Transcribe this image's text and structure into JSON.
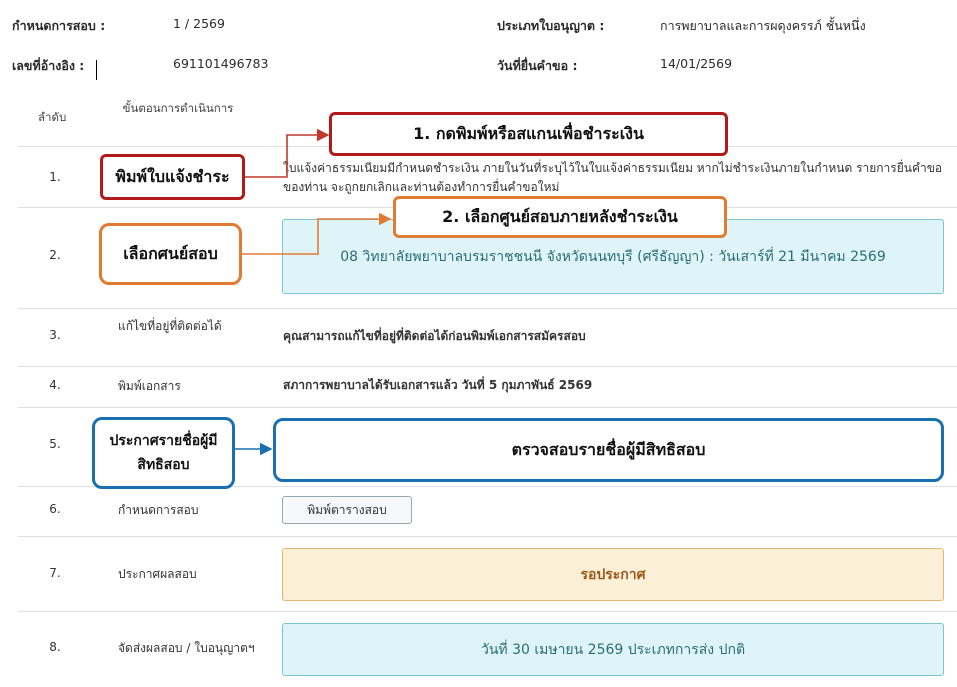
{
  "header": {
    "exam_round_label": "กำหนดการสอบ :",
    "exam_round_value": "1 / 2569",
    "license_type_label": "ประเภทใบอนุญาต :",
    "license_type_value": "การพยาบาลและการผดุงครรภ์ ชั้นหนึ่ง",
    "ref_no_label": "เลขที่อ้างอิง :",
    "ref_no_value": "691101496783",
    "submit_date_label": "วันที่ยื่นคำขอ :",
    "submit_date_value": "14/01/2569"
  },
  "table": {
    "col_order": "ลำดับ",
    "col_step": "ขั้นตอนการดำเนินการ"
  },
  "rows": [
    {
      "num": "1.",
      "detail": "ใบแจ้งค่าธรรมเนียมมีกำหนดชำระเงิน ภายในวันที่ระบุไว้ในใบแจ้งค่าธรรมเนียม หากไม่ชำระเงินภายในกำหนด รายการยื่นคำขอของท่าน จะถูกยกเลิกและท่านต้องทำการยื่นคำขอใหม่"
    },
    {
      "num": "2.",
      "panel": "08 วิทยาลัยพยาบาลบรมราชชนนี จังหวัดนนทบุรี (ศรีธัญญา) : วันเสาร์ที่ 21 มีนาคม 2569"
    },
    {
      "num": "3.",
      "step": "แก้ไขที่อยู่ที่ติดต่อได้",
      "detail": "คุณสามารถแก้ไขที่อยู่ที่ติดต่อได้ก่อนพิมพ์เอกสารสมัครสอบ"
    },
    {
      "num": "4.",
      "step": "พิมพ์เอกสาร",
      "detail": "สภาการพยาบาลได้รับเอกสารแล้ว วันที่ 5 กุมภาพันธ์ 2569"
    },
    {
      "num": "5."
    },
    {
      "num": "6.",
      "step": "กำหนดการสอบ",
      "button": "พิมพ์ตารางสอบ"
    },
    {
      "num": "7.",
      "step": "ประกาศผลสอบ",
      "panel": "รอประกาศ"
    },
    {
      "num": "8.",
      "step": "จัดส่งผลสอบ / ใบอนุญาตฯ",
      "panel": "วันที่ 30 เมษายน 2569 ประเภทการส่ง ปกติ"
    }
  ],
  "callouts": {
    "print_invoice": "พิมพ์ใบแจ้งชำระ",
    "step1_instruction": "1. กดพิมพ์หรือสแกนเพื่อชำระเงิน",
    "select_center": "เลือกศนย์สอบ",
    "step2_instruction": "2. เลือกศูนย์สอบภายหลังชำระเงิน",
    "announce_list": "ประกาศรายชื่อผู้มีสิทธิสอบ",
    "check_list": "ตรวจสอบรายชื่อผู้มีสิทธิสอบ"
  },
  "colors": {
    "red": "#b01a1a",
    "orange": "#e07b33",
    "blue": "#1a6fb0",
    "info_bg": "#dff4f8",
    "warn_bg": "#fcefd8"
  }
}
